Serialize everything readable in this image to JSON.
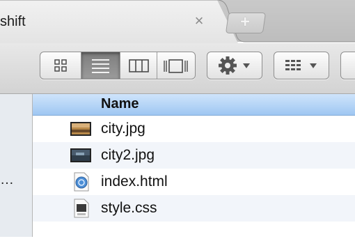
{
  "tab": {
    "title": "shift",
    "close_symbol": "×",
    "new_symbol": "+"
  },
  "toolbar": {
    "view_modes": [
      "icon-view",
      "list-view",
      "column-view",
      "cover-flow-view"
    ],
    "selected_view": "list-view",
    "action_menu": "gear-icon",
    "arrange_menu": "arrange-icon"
  },
  "sidebar": {
    "ellipsis": "…"
  },
  "list": {
    "column_header": "Name",
    "rows": [
      {
        "name": "city.jpg",
        "icon": "image-icon"
      },
      {
        "name": "city2.jpg",
        "icon": "image-icon"
      },
      {
        "name": "index.html",
        "icon": "html-document-icon"
      },
      {
        "name": "style.css",
        "icon": "css-document-icon"
      }
    ]
  },
  "colors": {
    "header_blue": "#9fc7f2",
    "row_alt": "#f2f5fa",
    "selected_segment": "#8a8a8a"
  }
}
